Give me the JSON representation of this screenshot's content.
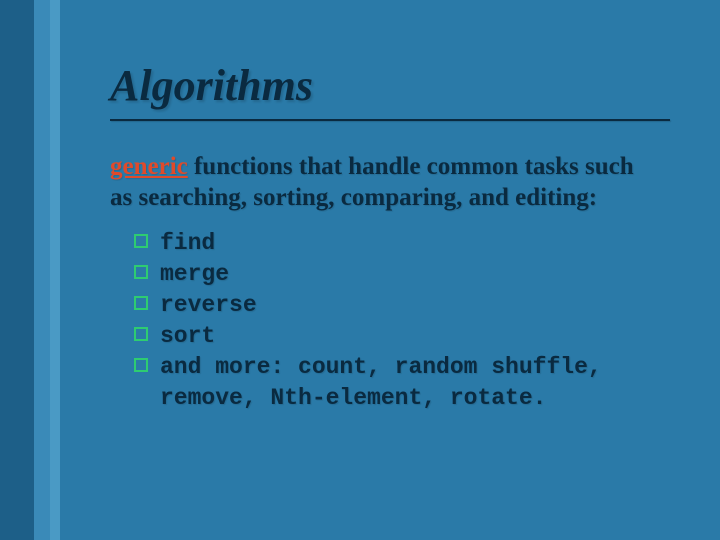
{
  "title": "Algorithms",
  "body": {
    "generic_word": "generic",
    "rest": " functions that handle common tasks such as searching, sorting, comparing, and editing:"
  },
  "bullets": [
    "find",
    "merge",
    "reverse",
    "sort",
    "and more: count, random shuffle, remove, Nth-element, rotate."
  ]
}
